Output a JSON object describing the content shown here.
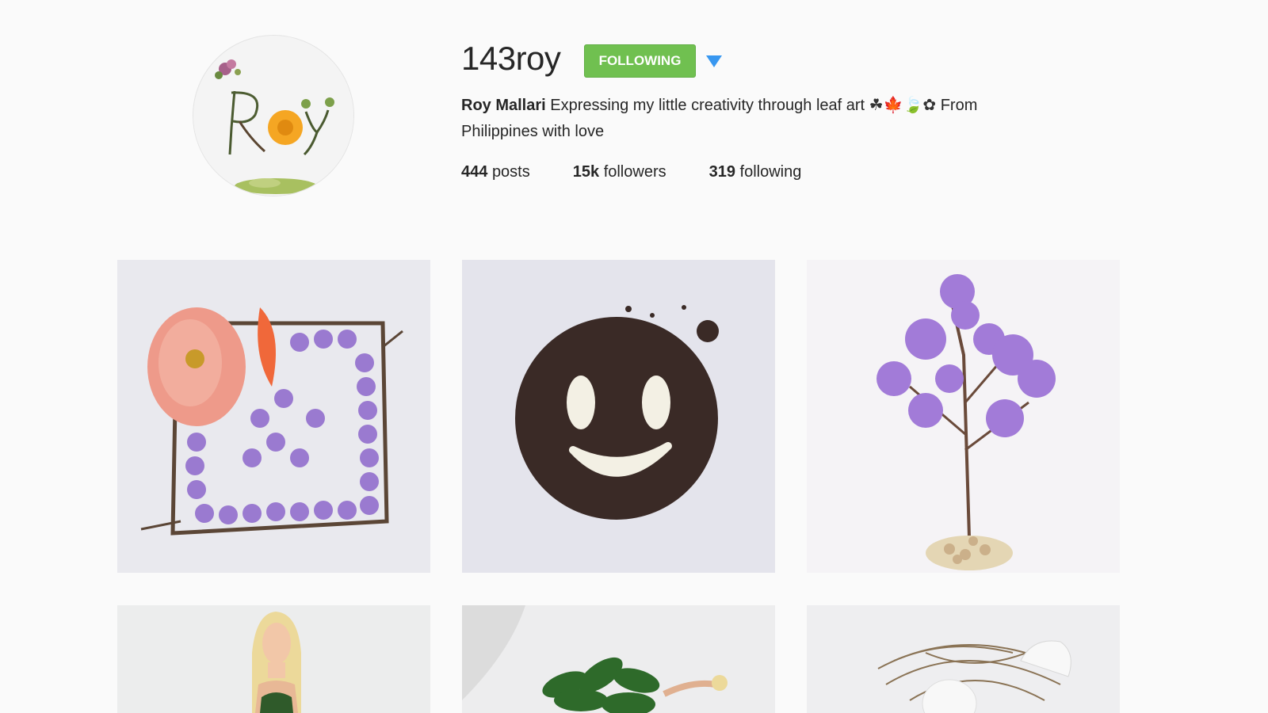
{
  "profile": {
    "username": "143roy",
    "follow_button_label": "FOLLOWING",
    "full_name": "Roy Mallari",
    "bio_text": "Expressing my little creativity through leaf art",
    "bio_emoji": "☘🍁🍃✿",
    "bio_suffix": "From Philippines with love",
    "stats": [
      {
        "value": "444",
        "label": "posts"
      },
      {
        "value": "15k",
        "label": "followers"
      },
      {
        "value": "319",
        "label": "following"
      }
    ],
    "avatar_icon": "leaf-art-avatar-icon"
  },
  "colors": {
    "follow_button": "#70c050",
    "dropdown_arrow": "#3897f0",
    "background": "#fafafa"
  },
  "posts": [
    {
      "icon": "flower-frame-photo"
    },
    {
      "icon": "cookie-smiley-photo"
    },
    {
      "icon": "purple-tree-photo"
    },
    {
      "icon": "doll-photo"
    },
    {
      "icon": "green-leaves-photo"
    },
    {
      "icon": "bird-nest-egg-photo"
    }
  ]
}
